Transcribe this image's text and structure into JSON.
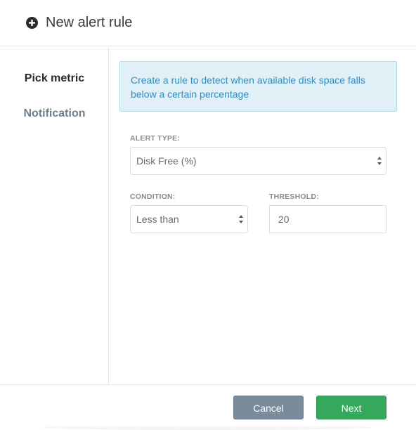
{
  "header": {
    "title": "New alert rule",
    "icon": "plus-circle-icon"
  },
  "sidebar": {
    "steps": [
      {
        "label": "Pick metric",
        "active": true
      },
      {
        "label": "Notification",
        "active": false
      }
    ]
  },
  "info": {
    "text": "Create a rule to detect when available disk space falls below a certain percentage"
  },
  "form": {
    "alert_type": {
      "label": "ALERT TYPE:",
      "value": "Disk Free (%)"
    },
    "condition": {
      "label": "CONDITION:",
      "value": "Less than"
    },
    "threshold": {
      "label": "THRESHOLD:",
      "value": "20"
    }
  },
  "footer": {
    "cancel_label": "Cancel",
    "next_label": "Next"
  },
  "colors": {
    "info_bg": "#e1eff6",
    "info_text": "#2f8ec0",
    "cancel_bg": "#7a8c9c",
    "next_bg": "#35a85b"
  }
}
